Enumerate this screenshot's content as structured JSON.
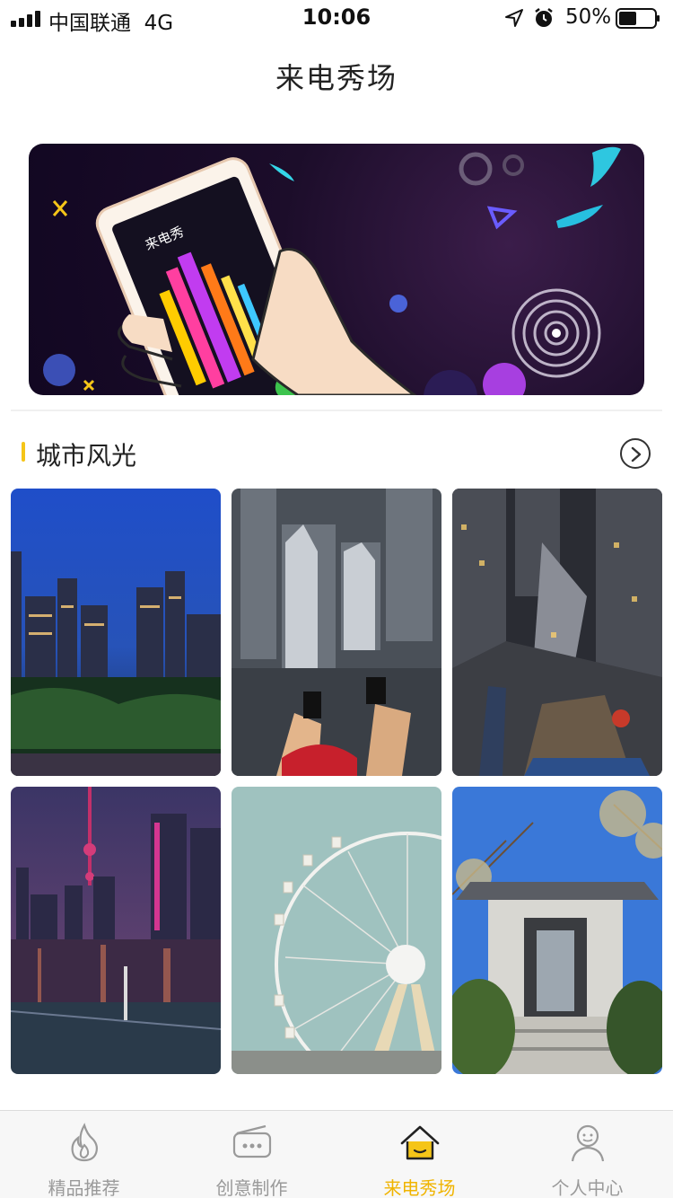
{
  "status_bar": {
    "carrier": "中国联通",
    "network": "4G",
    "time": "10:06",
    "battery": "50%",
    "battery_level": 0.5,
    "icons": [
      "signal-icon",
      "location-icon",
      "alarm-icon",
      "battery-icon"
    ]
  },
  "header": {
    "title": "来电秀场"
  },
  "banner": {
    "phone_screen_text": "来电秀",
    "description_icons": [
      "phone-hand-illustration",
      "answer-call-icon",
      "decline-call-icon"
    ]
  },
  "section": {
    "title": "城市风光",
    "accent_color": "#f5c518",
    "more_icon": "chevron-right-circle-icon"
  },
  "gallery": [
    {
      "name": "city-night-skyline"
    },
    {
      "name": "rooftop-view-feet"
    },
    {
      "name": "rooftop-street-view"
    },
    {
      "name": "shanghai-bund-night"
    },
    {
      "name": "ferris-wheel"
    },
    {
      "name": "garden-gate"
    }
  ],
  "tabs": [
    {
      "label": "精品推荐",
      "icon": "flame-icon",
      "active": false
    },
    {
      "label": "创意制作",
      "icon": "radio-icon",
      "active": false
    },
    {
      "label": "来电秀场",
      "icon": "home-icon",
      "active": true
    },
    {
      "label": "个人中心",
      "icon": "user-icon",
      "active": false
    }
  ],
  "colors": {
    "active_tab": "#f0b400",
    "inactive_tab": "#9a9a9a"
  }
}
